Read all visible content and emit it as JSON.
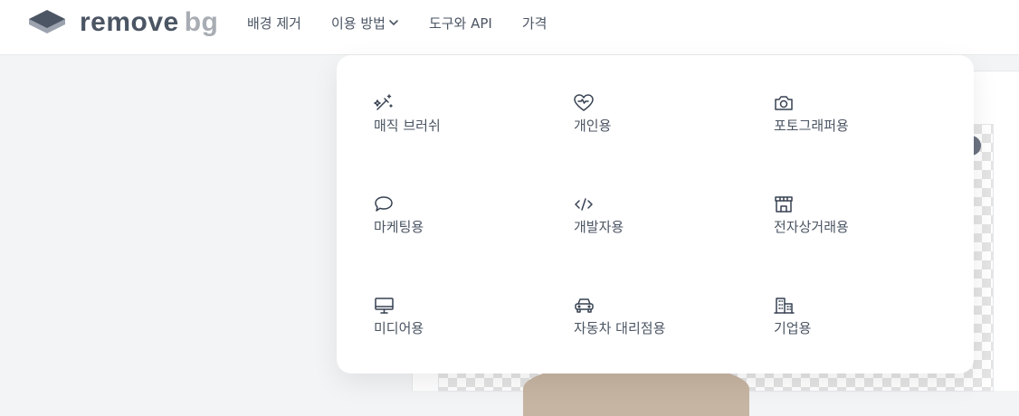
{
  "brand": {
    "name_primary": "remove",
    "name_secondary": "bg"
  },
  "nav": {
    "items": [
      {
        "label": "배경 제거"
      },
      {
        "label": "이용 방법"
      },
      {
        "label": "도구와 API"
      },
      {
        "label": "가격"
      }
    ]
  },
  "dropdown": {
    "items": [
      {
        "label": "매직 브러쉬",
        "icon": "magic-brush-icon"
      },
      {
        "label": "개인용",
        "icon": "heart-icon"
      },
      {
        "label": "포토그래퍼용",
        "icon": "camera-icon"
      },
      {
        "label": "마케팅용",
        "icon": "chat-bubble-icon"
      },
      {
        "label": "개발자용",
        "icon": "code-icon"
      },
      {
        "label": "전자상거래용",
        "icon": "storefront-icon"
      },
      {
        "label": "미디어용",
        "icon": "monitor-icon"
      },
      {
        "label": "자동차 대리점용",
        "icon": "car-icon"
      },
      {
        "label": "기업용",
        "icon": "building-icon"
      }
    ]
  }
}
